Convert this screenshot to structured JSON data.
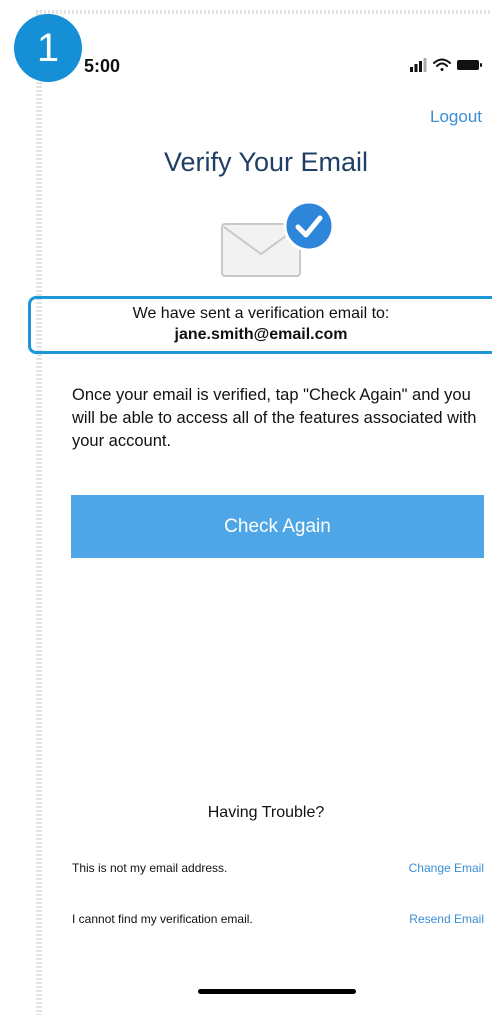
{
  "step_badge": "1",
  "status_bar": {
    "time": "5:00"
  },
  "header": {
    "logout_label": "Logout",
    "title": "Verify Your Email"
  },
  "verification": {
    "sent_text": "We have sent a verification email to:",
    "email": "jane.smith@email.com"
  },
  "info_text": "Once your email is verified, tap \"Check Again\" and you will be able to access all of the features associated with your account.",
  "check_button_label": "Check Again",
  "trouble": {
    "title": "Having Trouble?",
    "rows": [
      {
        "label": "This is not my email address.",
        "action": "Change Email"
      },
      {
        "label": "I cannot find my verification email.",
        "action": "Resend Email"
      }
    ]
  },
  "colors": {
    "accent": "#4fa6e6",
    "link": "#3b8fd6",
    "title": "#1f3f66",
    "highlight_border": "#1e97d8",
    "badge": "#1590d6"
  }
}
